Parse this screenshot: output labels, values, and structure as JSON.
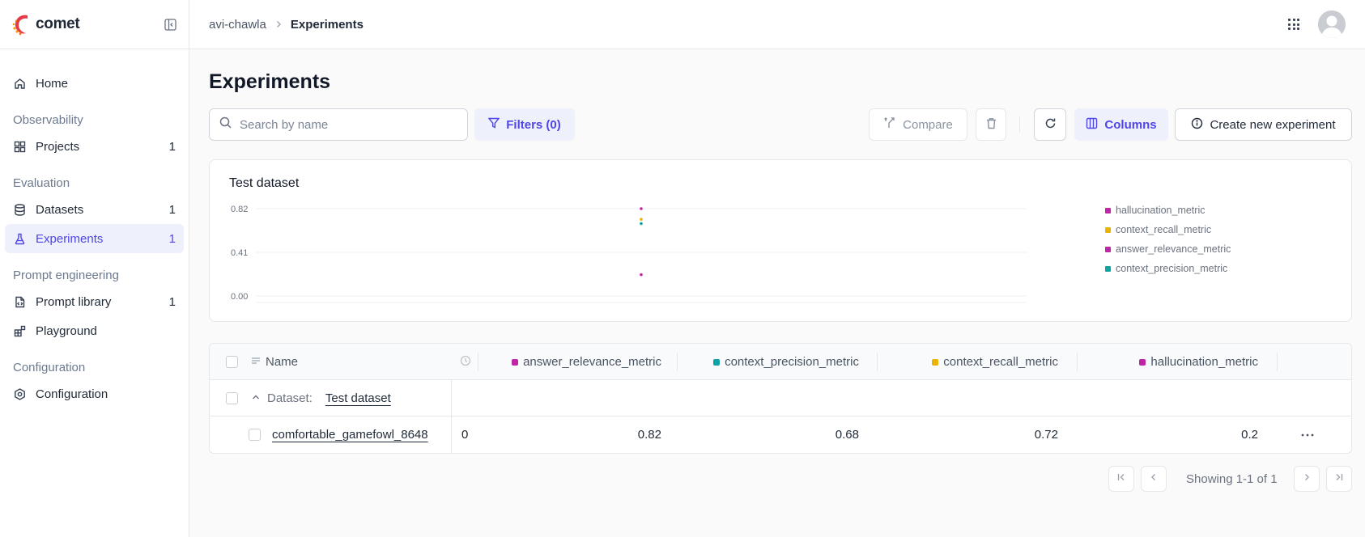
{
  "app": {
    "brand": "comet"
  },
  "sidebar": {
    "home": {
      "label": "Home"
    },
    "sections": [
      {
        "title": "Observability",
        "items": [
          {
            "label": "Projects",
            "count": "1",
            "icon": "grid-icon"
          }
        ]
      },
      {
        "title": "Evaluation",
        "items": [
          {
            "label": "Datasets",
            "count": "1",
            "icon": "database-icon"
          },
          {
            "label": "Experiments",
            "count": "1",
            "icon": "flask-icon",
            "active": true
          }
        ]
      },
      {
        "title": "Prompt engineering",
        "items": [
          {
            "label": "Prompt library",
            "count": "1",
            "icon": "file-code-icon"
          },
          {
            "label": "Playground",
            "count": "",
            "icon": "blocks-icon"
          }
        ]
      },
      {
        "title": "Configuration",
        "items": [
          {
            "label": "Configuration",
            "count": "",
            "icon": "settings-hexagon-icon"
          }
        ]
      }
    ]
  },
  "header": {
    "breadcrumb": [
      "avi-chawla",
      "Experiments"
    ]
  },
  "page": {
    "title": "Experiments"
  },
  "toolbar": {
    "search_placeholder": "Search by name",
    "filters_label": "Filters (0)",
    "compare_label": "Compare",
    "columns_label": "Columns",
    "create_label": "Create new experiment"
  },
  "colors": {
    "accent": "#4f46e5",
    "hallucination_metric": "#c026a3",
    "context_recall_metric": "#eab308",
    "answer_relevance_metric": "#c026a3",
    "context_precision_metric": "#0fa3a3"
  },
  "chart_data": {
    "type": "scatter",
    "title": "Test dataset",
    "ylim": [
      0,
      0.82
    ],
    "yticks": [
      "0.82",
      "0.41",
      "0.00"
    ],
    "grid": true,
    "legend_position": "right",
    "series": [
      {
        "name": "hallucination_metric",
        "color": "#c026a3",
        "values": [
          0.2
        ]
      },
      {
        "name": "context_recall_metric",
        "color": "#eab308",
        "values": [
          0.72
        ]
      },
      {
        "name": "answer_relevance_metric",
        "color": "#c026a3",
        "values": [
          0.82
        ]
      },
      {
        "name": "context_precision_metric",
        "color": "#0fa3a3",
        "values": [
          0.68
        ]
      }
    ]
  },
  "table": {
    "name_header": "Name",
    "metric_headers": [
      {
        "label": "answer_relevance_metric",
        "color": "#c026a3"
      },
      {
        "label": "context_precision_metric",
        "color": "#0fa3a3"
      },
      {
        "label": "context_recall_metric",
        "color": "#eab308"
      },
      {
        "label": "hallucination_metric",
        "color": "#c026a3"
      }
    ],
    "group": {
      "prefix": "Dataset:",
      "name": "Test dataset"
    },
    "rows": [
      {
        "name": "comfortable_gamefowl_8648",
        "duration": "0",
        "answer_relevance": "0.82",
        "context_precision": "0.68",
        "context_recall": "0.72",
        "hallucination": "0.2"
      }
    ]
  },
  "pagination": {
    "info": "Showing 1-1 of 1"
  }
}
